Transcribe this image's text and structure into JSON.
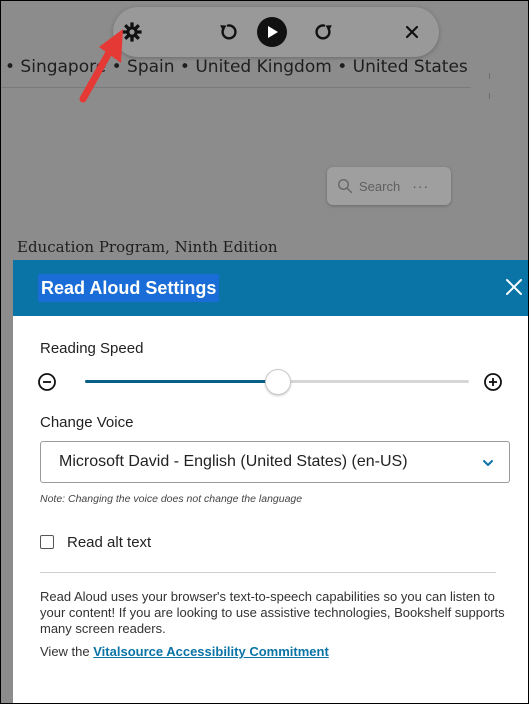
{
  "background": {
    "countries_text": "• Singapore • Spain • United Kingdom • United States",
    "book_title_fragment": "Education Program, Ninth Edition",
    "search": {
      "placeholder": "Search",
      "more_label": "···"
    }
  },
  "toolbar": {
    "icons": [
      "gear-icon",
      "rewind-icon",
      "play-icon",
      "forward-icon",
      "close-icon"
    ]
  },
  "annotation": {
    "arrow_color": "#e53935"
  },
  "panel": {
    "title": "Read Aloud Settings",
    "header_color": "#0a74a6",
    "reading_speed": {
      "label": "Reading Speed",
      "value_fraction": 0.5
    },
    "voice": {
      "label": "Change Voice",
      "selected": "Microsoft David - English (United States) (en-US)",
      "note": "Note: Changing the voice does not change the language"
    },
    "alt_text": {
      "label": "Read alt text",
      "checked": false
    },
    "info": {
      "description": "Read Aloud uses your browser's text-to-speech capabilities so you can listen to your content! If you are looking to use assistive technologies, Bookshelf supports many screen readers.",
      "view_prefix": "View the ",
      "link_text": "Vitalsource Accessibility Commitment"
    }
  }
}
